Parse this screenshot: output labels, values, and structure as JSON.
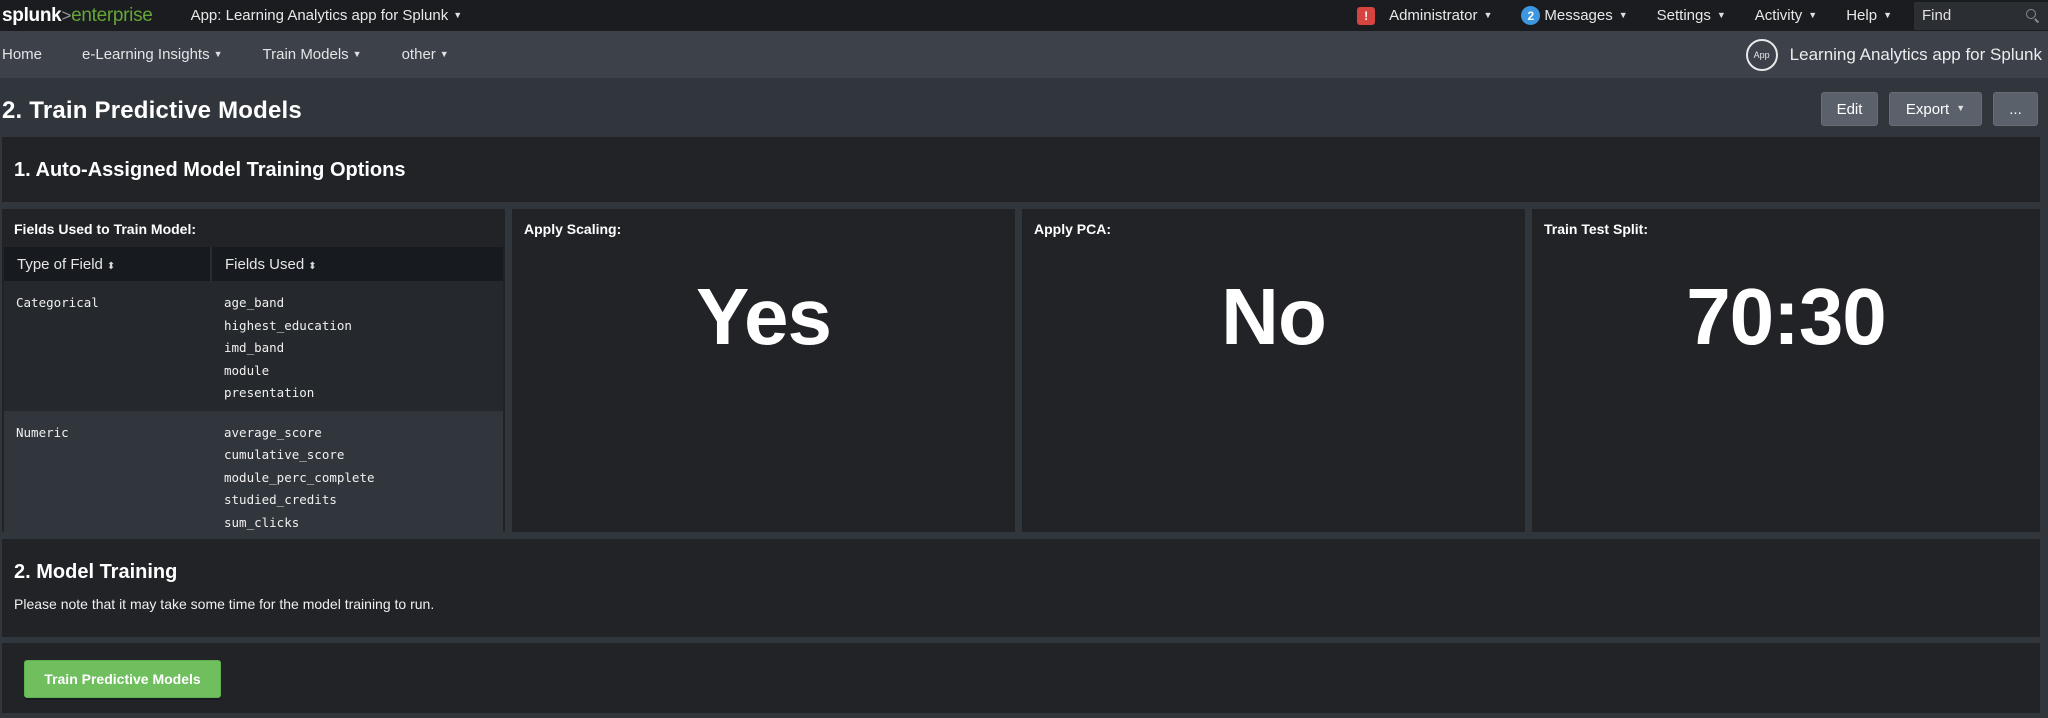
{
  "topbar": {
    "logo_brand": "splunk",
    "logo_separator": ">",
    "logo_product": "enterprise",
    "app_menu_label": "App: Learning Analytics app for Splunk",
    "alert_icon": "!",
    "user_label": "Administrator",
    "messages_count": "2",
    "messages_label": "Messages",
    "settings_label": "Settings",
    "activity_label": "Activity",
    "help_label": "Help",
    "find_placeholder": "Find",
    "caret_glyph": "▼"
  },
  "navbar": {
    "items": [
      {
        "label": "Home",
        "has_menu": false
      },
      {
        "label": "e-Learning Insights",
        "has_menu": true
      },
      {
        "label": "Train Models",
        "has_menu": true
      },
      {
        "label": "other",
        "has_menu": true
      }
    ],
    "app_badge": "App",
    "app_title": "Learning Analytics app for Splunk"
  },
  "page": {
    "title": "2. Train Predictive Models",
    "buttons": {
      "edit": "Edit",
      "export": "Export",
      "more": "..."
    }
  },
  "section1": {
    "title": "1. Auto-Assigned Model Training Options",
    "fields_panel": {
      "title": "Fields Used to Train Model:",
      "columns": [
        "Type of Field",
        "Fields Used"
      ],
      "sort_glyph": "⬍",
      "rows": [
        {
          "type": "Categorical",
          "fields": [
            "age_band",
            "highest_education",
            "imd_band",
            "module",
            "presentation"
          ]
        },
        {
          "type": "Numeric",
          "fields": [
            "average_score",
            "cumulative_score",
            "module_perc_complete",
            "studied_credits",
            "sum_clicks"
          ]
        }
      ]
    },
    "scaling": {
      "title": "Apply Scaling:",
      "value": "Yes"
    },
    "pca": {
      "title": "Apply PCA:",
      "value": "No"
    },
    "split": {
      "title": "Train Test Split:",
      "value": "70:30"
    }
  },
  "section2": {
    "title": "2. Model Training",
    "note": "Please note that it may take some time for the model training to run.",
    "button_label": "Train Predictive Models",
    "button_color": "#6fbf5f"
  },
  "colors": {
    "topbar_bg": "#1a1c20",
    "navbar_bg": "#3c414a",
    "page_bg": "#31353c",
    "panel_bg": "#212327",
    "accent_green": "#65a637",
    "alert_red": "#d6443f",
    "badge_blue": "#3c97e0"
  }
}
